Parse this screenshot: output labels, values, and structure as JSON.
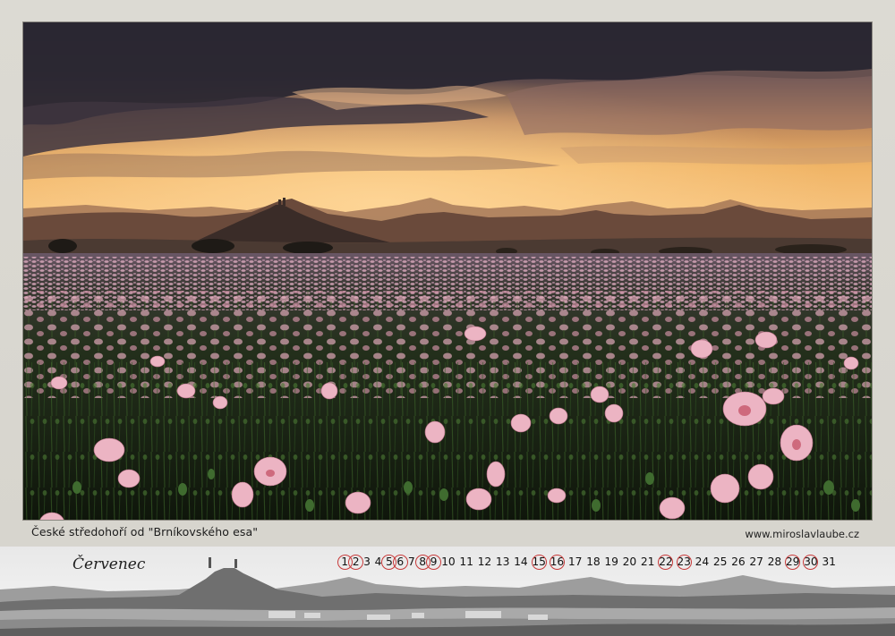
{
  "photo": {
    "caption": "České středohoří od \"Brníkovského esa\""
  },
  "credit": {
    "website": "www.miroslavlaube.cz"
  },
  "calendar": {
    "month": "Červenec",
    "days": [
      {
        "label": "1",
        "highlighted": true
      },
      {
        "label": "2",
        "highlighted": true
      },
      {
        "label": "3",
        "highlighted": false
      },
      {
        "label": "4",
        "highlighted": false
      },
      {
        "label": "5",
        "highlighted": true
      },
      {
        "label": "6",
        "highlighted": true
      },
      {
        "label": "7",
        "highlighted": false
      },
      {
        "label": "8",
        "highlighted": true
      },
      {
        "label": "9",
        "highlighted": true
      },
      {
        "label": "10",
        "highlighted": false
      },
      {
        "label": "11",
        "highlighted": false
      },
      {
        "label": "12",
        "highlighted": false
      },
      {
        "label": "13",
        "highlighted": false
      },
      {
        "label": "14",
        "highlighted": false
      },
      {
        "label": "15",
        "highlighted": true
      },
      {
        "label": "16",
        "highlighted": true
      },
      {
        "label": "17",
        "highlighted": false
      },
      {
        "label": "18",
        "highlighted": false
      },
      {
        "label": "19",
        "highlighted": false
      },
      {
        "label": "20",
        "highlighted": false
      },
      {
        "label": "21",
        "highlighted": false
      },
      {
        "label": "22",
        "highlighted": true
      },
      {
        "label": "23",
        "highlighted": true
      },
      {
        "label": "24",
        "highlighted": false
      },
      {
        "label": "25",
        "highlighted": false
      },
      {
        "label": "26",
        "highlighted": false
      },
      {
        "label": "27",
        "highlighted": false
      },
      {
        "label": "28",
        "highlighted": false
      },
      {
        "label": "29",
        "highlighted": true
      },
      {
        "label": "30",
        "highlighted": true
      },
      {
        "label": "31",
        "highlighted": false
      }
    ],
    "highlight_color": "#c83a3a"
  },
  "colors": {
    "sky_top": "#2d2a35",
    "sunset_glow": "#f3b866",
    "poppy": "#e9a5b4",
    "field_green": "#1e2a17"
  }
}
